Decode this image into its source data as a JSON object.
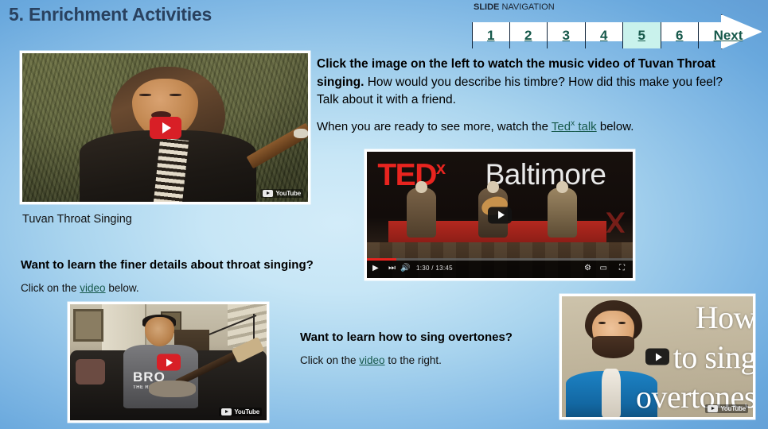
{
  "slide": {
    "title": "5. Enrichment Activities",
    "background_center": "#cce9f7",
    "background_edge": "#69a8dd"
  },
  "navigation": {
    "label_bold": "SLIDE",
    "label_rest": " NAVIGATION",
    "active_index": 4,
    "active_color": "#c9f2ec",
    "link_color": "#17594b",
    "items": [
      {
        "label": "1"
      },
      {
        "label": "2"
      },
      {
        "label": "3"
      },
      {
        "label": "4"
      },
      {
        "label": "5"
      },
      {
        "label": "6"
      },
      {
        "label": "Next"
      }
    ]
  },
  "body": {
    "para1_bold": "Click  the image on the left to watch the music video of Tuvan Throat singing.",
    "para1_rest": "  How would you describe his timbre? How did this make you feel? Talk about it with a friend.",
    "para2_before": "When you are ready to see more, watch the ",
    "para2_link": "Ted",
    "para2_link_sup": "x",
    "para2_link_rest": " talk",
    "para2_after": " below."
  },
  "captions": {
    "tuvan_caption": "Tuvan Throat Singing",
    "finer_details_question": "Want to learn the finer details about throat singing?",
    "click_below_before": "Click on the ",
    "click_below_link": "video",
    "click_below_after": " below.",
    "overtones_question": "Want to learn how to sing overtones?",
    "click_right_before": "Click on the ",
    "click_right_link": "video",
    "click_right_after": " to the right."
  },
  "media": {
    "tuvan_video": {
      "name": "Tuvan throat singing music video thumbnail",
      "watermark": "YouTube"
    },
    "tedx_video": {
      "name": "TEDx Baltimore throat singing talk",
      "logo_ted": "TED",
      "logo_x": "x",
      "logo_city": "Baltimore",
      "time": "1:30 / 13:45",
      "controls": {
        "play": "▶",
        "next": "⏭",
        "volume": "🔊",
        "settings": "⚙",
        "theater": "▭",
        "fullscreen": "⛶"
      }
    },
    "bro_video": {
      "name": "Throat singing finer details video thumbnail",
      "shirt_text": "BRO",
      "shirt_subtext": "THE ROCK",
      "watermark": "YouTube"
    },
    "overtones_video": {
      "name": "How to sing overtones video thumbnail",
      "line1": "How",
      "line2": "to sing",
      "line3": "overtones",
      "watermark": "YouTube"
    }
  }
}
